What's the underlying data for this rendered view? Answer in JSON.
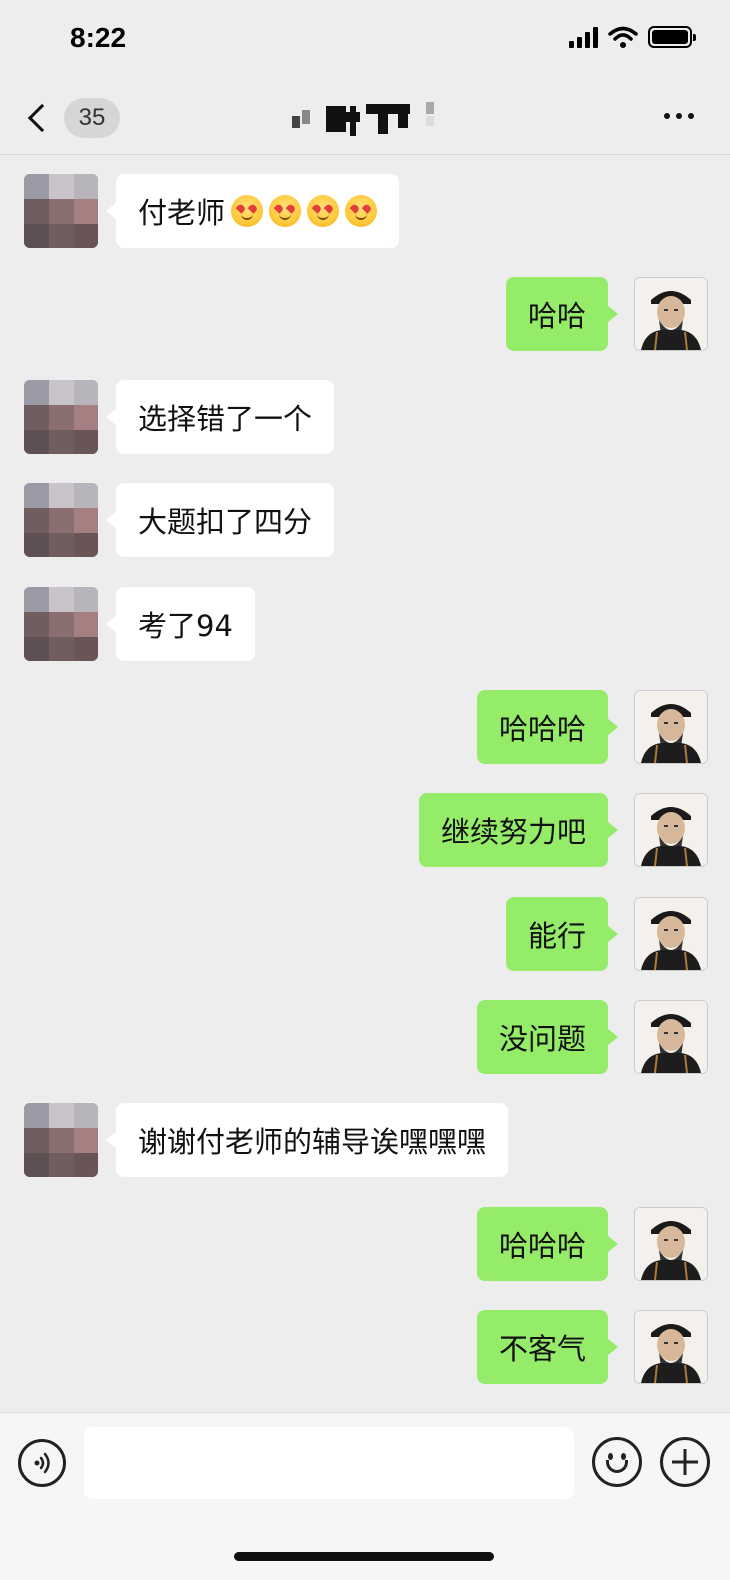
{
  "status_bar": {
    "time": "8:22"
  },
  "nav": {
    "unread_count": "35",
    "title_blurred": true
  },
  "messages": [
    {
      "side": "left",
      "text": "付老师",
      "emoji_count": 4,
      "emoji_name": "star-struck-face"
    },
    {
      "side": "right",
      "text": "哈哈"
    },
    {
      "side": "left",
      "text": "选择错了一个"
    },
    {
      "side": "left",
      "text": "大题扣了四分"
    },
    {
      "side": "left",
      "text": "考了94"
    },
    {
      "side": "right",
      "text": "哈哈哈"
    },
    {
      "side": "right",
      "text": "继续努力吧"
    },
    {
      "side": "right",
      "text": "能行"
    },
    {
      "side": "right",
      "text": "没问题"
    },
    {
      "side": "left",
      "text": "谢谢付老师的辅导诶嘿嘿嘿"
    },
    {
      "side": "right",
      "text": "哈哈哈"
    },
    {
      "side": "right",
      "text": "不客气"
    }
  ],
  "input_bar": {
    "voice_icon": "voice-icon",
    "emoji_icon": "emoji-icon",
    "plus_icon": "plus-icon",
    "message_value": ""
  },
  "colors": {
    "background": "#ededed",
    "sent_bubble": "#95ec69",
    "received_bubble": "#ffffff"
  }
}
